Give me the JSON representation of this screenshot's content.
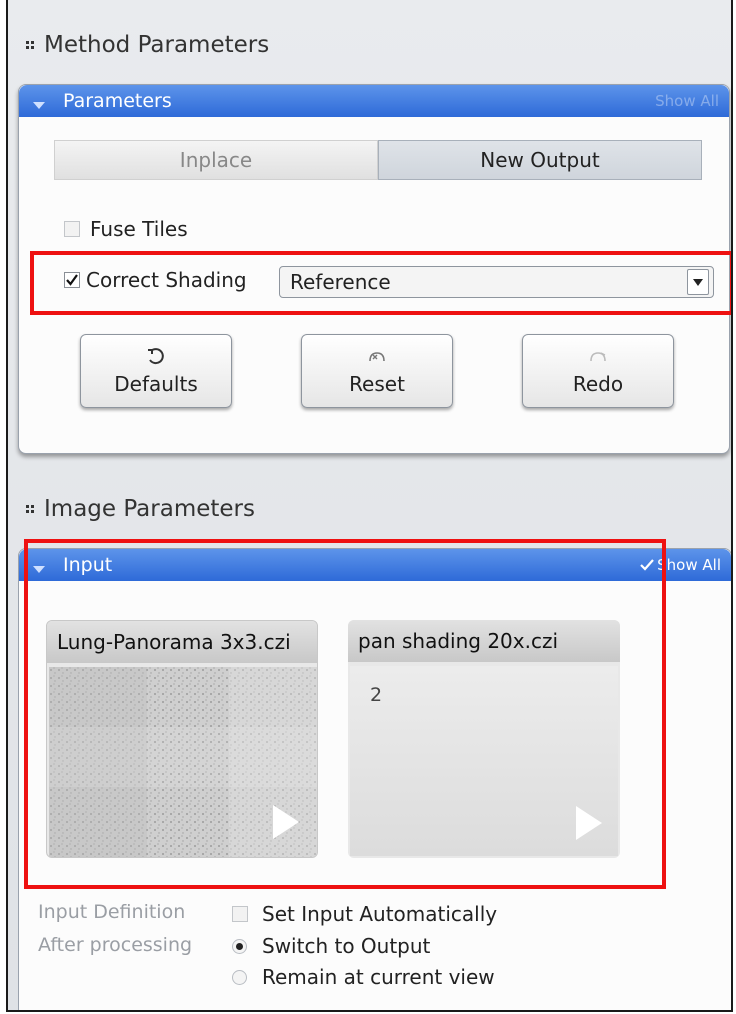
{
  "method_section": {
    "title": "Method Parameters"
  },
  "parameters_panel": {
    "title": "Parameters",
    "header_right": "Show All",
    "tabs": [
      {
        "label": "Inplace",
        "active": false
      },
      {
        "label": "New Output",
        "active": true
      }
    ],
    "fuse_tiles": {
      "label": "Fuse Tiles",
      "checked": false
    },
    "correct_shading": {
      "label": "Correct Shading",
      "checked": true,
      "selected": "Reference"
    },
    "buttons": {
      "defaults": "Defaults",
      "reset": "Reset",
      "redo": "Redo"
    }
  },
  "image_section": {
    "title": "Image Parameters"
  },
  "input_panel": {
    "title": "Input",
    "show_all": "Show All",
    "thumbnails": [
      {
        "name": "Lung-Panorama 3x3.czi",
        "badge": ""
      },
      {
        "name": "pan shading 20x.czi",
        "badge": "2"
      }
    ]
  },
  "footer": {
    "input_definition_label": "Input Definition",
    "set_input_auto": {
      "label": "Set Input Automatically",
      "checked": false
    },
    "after_processing_label": "After processing",
    "switch_to_output": {
      "label": "Switch to Output",
      "selected": true
    },
    "remain_current": {
      "label": "Remain at current view",
      "selected": false
    }
  },
  "colors": {
    "accent_blue": "#2e6ad8",
    "highlight_red": "#ee1111"
  }
}
